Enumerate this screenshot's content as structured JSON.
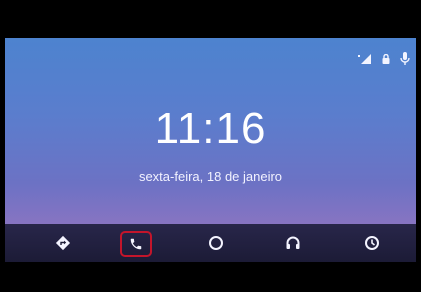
{
  "home": {
    "time": "11:16",
    "date": "sexta-feira, 18 de janeiro"
  },
  "status_icons": [
    "signal-icon",
    "lock-icon",
    "microphone-icon"
  ],
  "nav": {
    "items": [
      {
        "name": "navigation-icon",
        "selected": false
      },
      {
        "name": "phone-icon",
        "selected": true
      },
      {
        "name": "home-circle-icon",
        "selected": false
      },
      {
        "name": "headphones-icon",
        "selected": false
      },
      {
        "name": "exit-icon",
        "selected": false
      }
    ],
    "highlight_color": "#c4152b"
  },
  "colors": {
    "wallpaper_top": "#4d83cf",
    "wallpaper_bottom": "#9e7ec2",
    "nav_bar": "#1c1b36",
    "frame": "#000000"
  }
}
